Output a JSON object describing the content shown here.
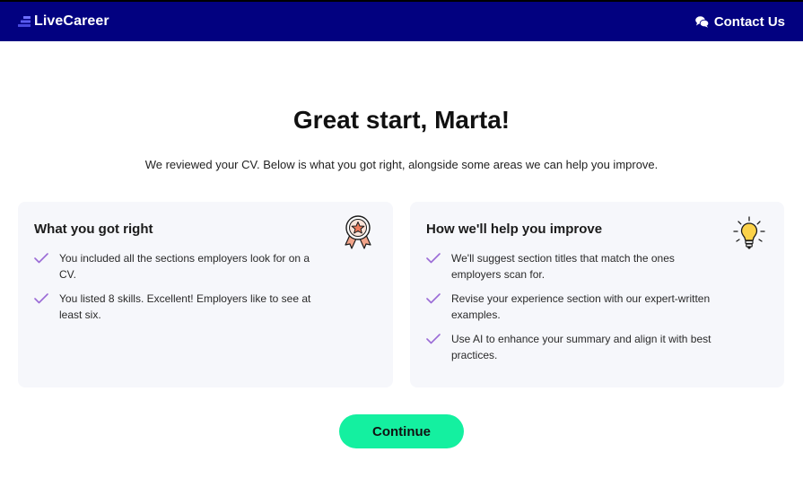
{
  "header": {
    "logo_text": "LiveCareer",
    "contact_label": "Contact Us"
  },
  "main": {
    "title": "Great start, Marta!",
    "subtitle": "We reviewed your CV. Below is what you got right, alongside some areas we can help you improve."
  },
  "cards": {
    "right_so_far": {
      "heading": "What you got right",
      "icon": "award-ribbon-icon",
      "items": [
        "You included all the sections employers look for on a CV.",
        "You listed 8 skills. Excellent! Employers like to see at least six."
      ]
    },
    "improve": {
      "heading": "How we'll help you improve",
      "icon": "lightbulb-icon",
      "items": [
        "We'll suggest section titles that match the ones employers scan for.",
        "Revise your experience section with our expert-written examples.",
        "Use AI to enhance your summary and align it with best practices."
      ]
    }
  },
  "actions": {
    "continue_label": "Continue"
  },
  "colors": {
    "header_bg": "#020180",
    "card_bg": "#f6f7fb",
    "check": "#9b6bd6",
    "continue_bg": "#14f0a0",
    "logo_mark": "#5b5cf0"
  }
}
